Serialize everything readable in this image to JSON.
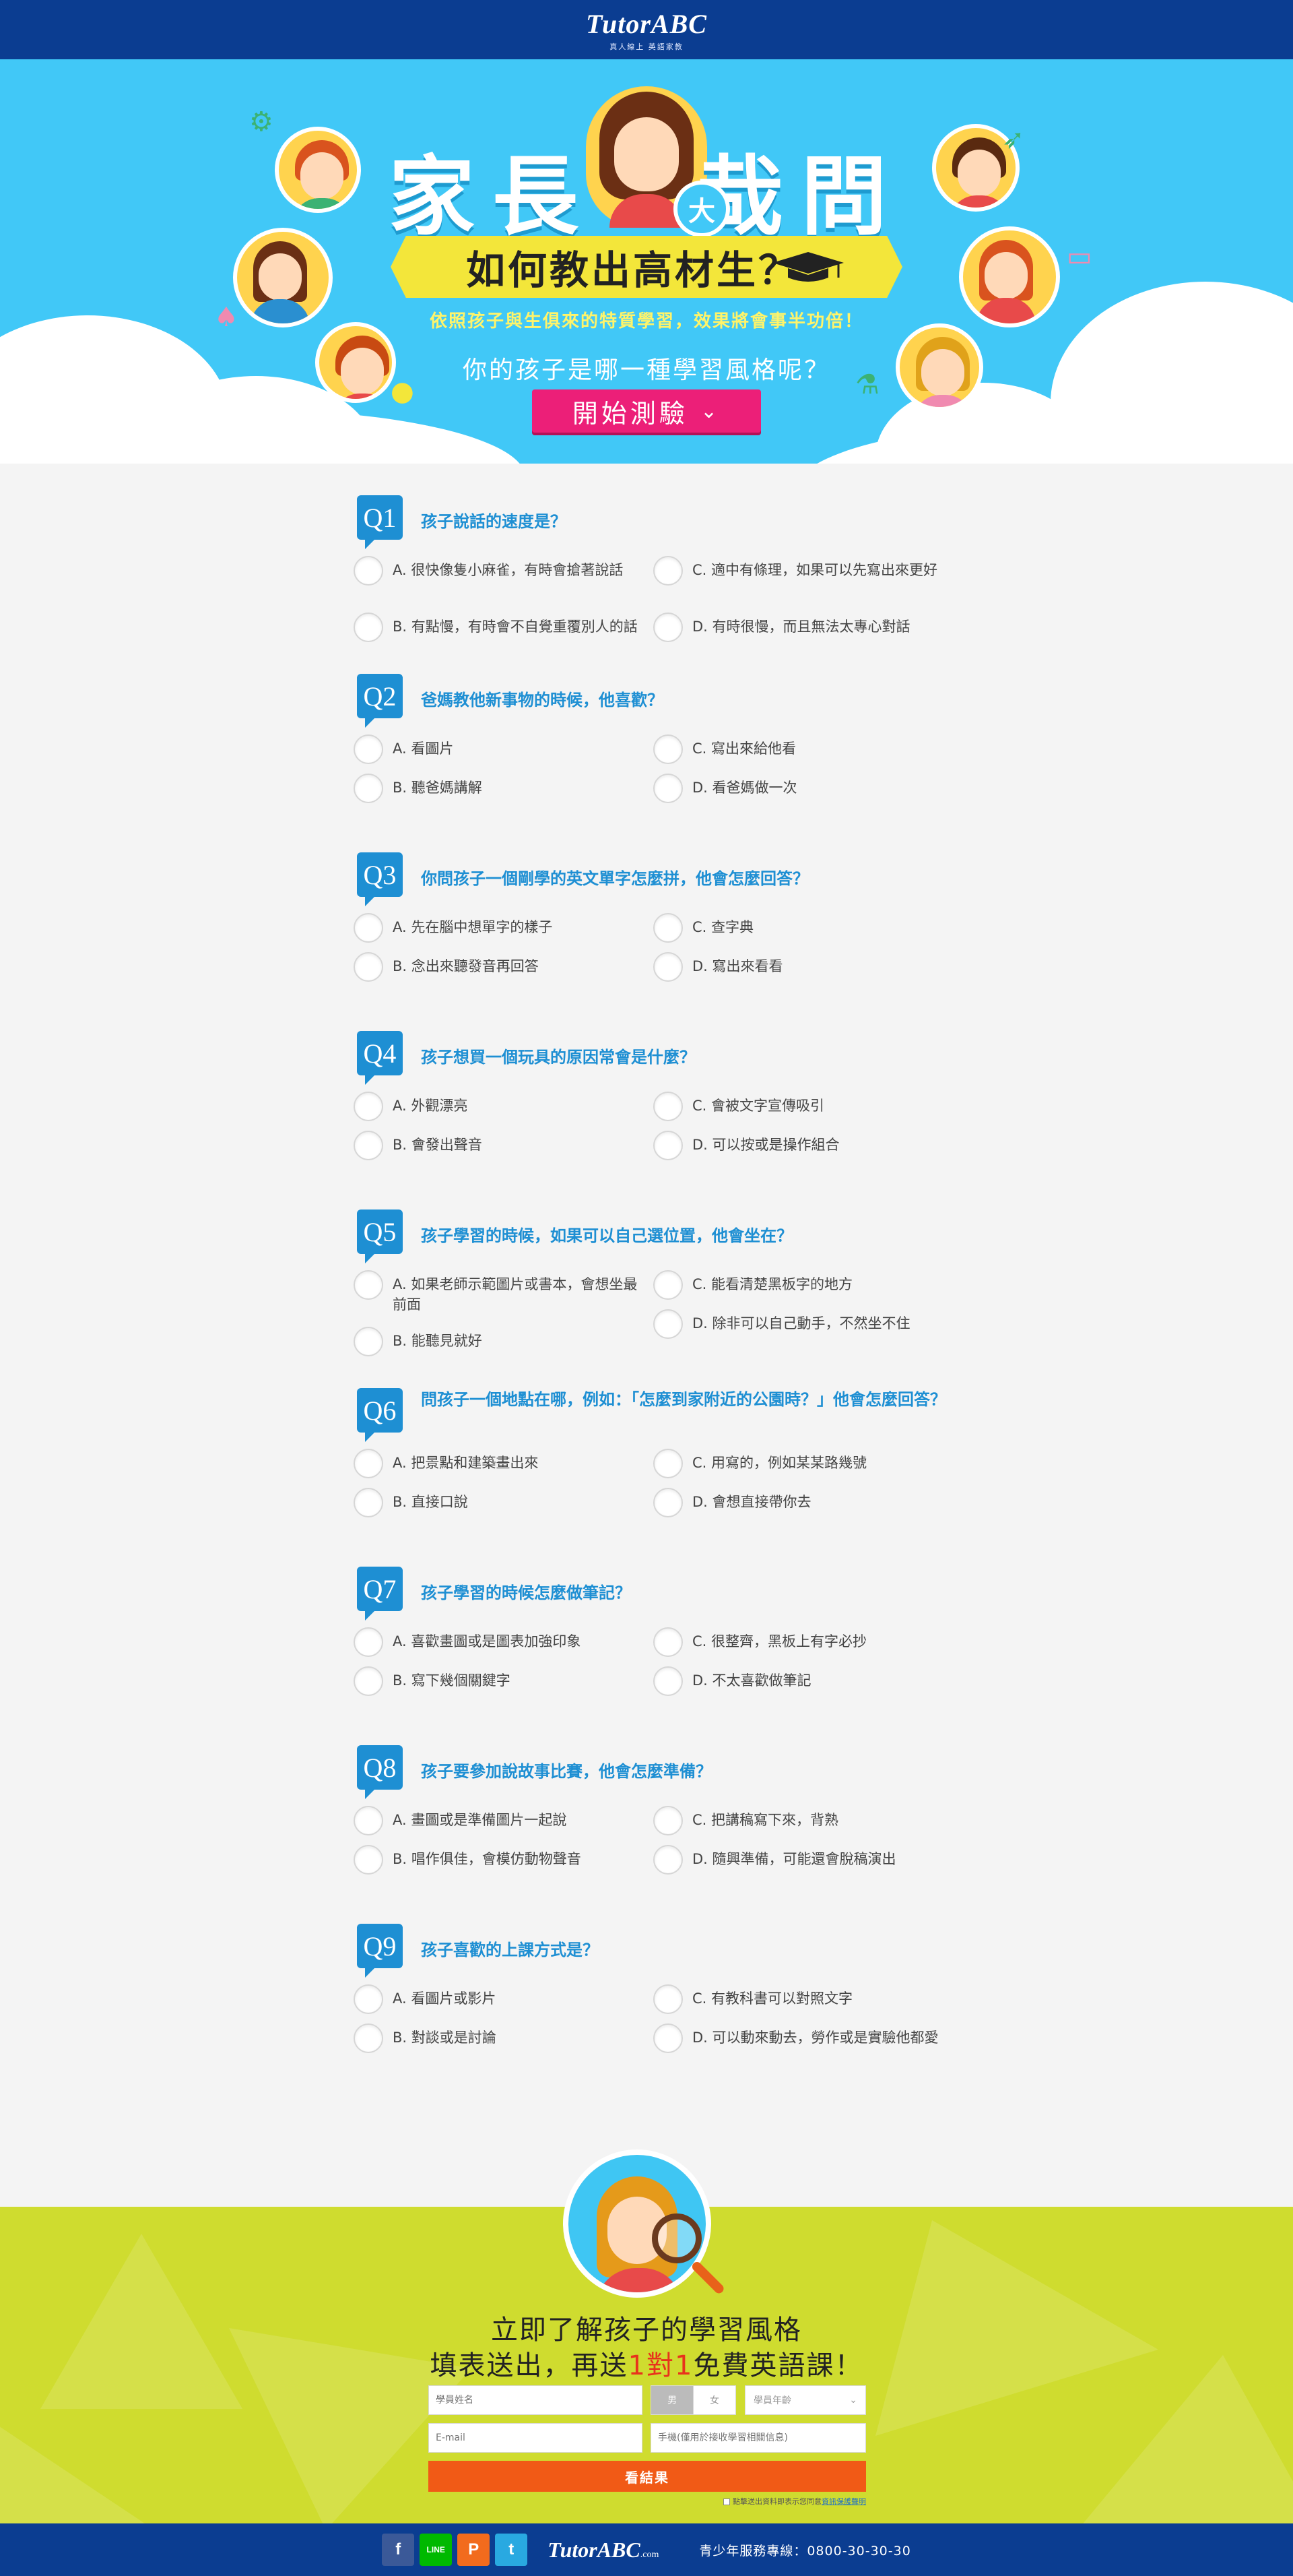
{
  "header": {
    "logo": "TutorABC",
    "tagline": "真人線上  英語家教"
  },
  "hero": {
    "title_left": "家長",
    "title_mid": "大",
    "title_right": "哉問",
    "ribbon": "如何教出高材生？",
    "subtitle": "依照孩子與生俱來的特質學習，效果將會事半功倍！",
    "question": "你的孩子是哪一種學習風格呢？",
    "start_button": "開始測驗",
    "colors": {
      "sky": "#41c8f7",
      "ribbon": "#f3e63a",
      "button": "#ec1f78"
    }
  },
  "quiz": {
    "questions": [
      {
        "num": "Q1",
        "text": "孩子說話的速度是？",
        "options": [
          "A. 很快像隻小麻雀，有時會搶著說話",
          "B. 有點慢，有時會不自覺重覆別人的話",
          "C. 適中有條理，如果可以先寫出來更好",
          "D. 有時很慢，而且無法太專心對話"
        ]
      },
      {
        "num": "Q2",
        "text": "爸媽教他新事物的時候，他喜歡？",
        "options": [
          "A. 看圖片",
          "B. 聽爸媽講解",
          "C. 寫出來給他看",
          "D. 看爸媽做一次"
        ]
      },
      {
        "num": "Q3",
        "text": "你問孩子一個剛學的英文單字怎麼拼，他會怎麼回答？",
        "options": [
          "A. 先在腦中想單字的樣子",
          "B. 念出來聽發音再回答",
          "C. 查字典",
          "D. 寫出來看看"
        ]
      },
      {
        "num": "Q4",
        "text": "孩子想買一個玩具的原因常會是什麼？",
        "options": [
          "A. 外觀漂亮",
          "B. 會發出聲音",
          "C. 會被文字宣傳吸引",
          "D. 可以按或是操作組合"
        ]
      },
      {
        "num": "Q5",
        "text": "孩子學習的時候，如果可以自己選位置，他會坐在？",
        "options": [
          "A. 如果老師示範圖片或書本，會想坐最前面",
          "B. 能聽見就好",
          "C. 能看清楚黑板字的地方",
          "D. 除非可以自己動手，不然坐不住"
        ]
      },
      {
        "num": "Q6",
        "text": "問孩子一個地點在哪，例如：「怎麼到家附近的公園時？」他會怎麼回答？",
        "options": [
          "A. 把景點和建築畫出來",
          "B. 直接口說",
          "C. 用寫的，例如某某路幾號",
          "D. 會想直接帶你去"
        ]
      },
      {
        "num": "Q7",
        "text": "孩子學習的時候怎麼做筆記？",
        "options": [
          "A. 喜歡畫圖或是圖表加強印象",
          "B. 寫下幾個關鍵字",
          "C. 很整齊，黑板上有字必抄",
          "D. 不太喜歡做筆記"
        ]
      },
      {
        "num": "Q8",
        "text": "孩子要參加說故事比賽，他會怎麼準備？",
        "options": [
          "A. 畫圖或是準備圖片一起說",
          "B. 唱作俱佳，會模仿動物聲音",
          "C. 把講稿寫下來，背熟",
          "D. 隨興準備，可能還會脫稿演出"
        ]
      },
      {
        "num": "Q9",
        "text": "孩子喜歡的上課方式是？",
        "options": [
          "A. 看圖片或影片",
          "B. 對談或是討論",
          "C. 有教科書可以對照文字",
          "D. 可以動來動去，勞作或是實驗他都愛"
        ]
      }
    ],
    "accent_color": "#1e8fd3"
  },
  "cta": {
    "line1": "立即了解孩子的學習風格",
    "line2_a": "填表送出，再送",
    "line2_hl": "1對1",
    "line2_b": "免費英語課！"
  },
  "form": {
    "name_placeholder": "學員姓名",
    "gender_male": "男",
    "gender_female": "女",
    "age_label": "學員年齡",
    "email_placeholder": "E-mail",
    "phone_placeholder": "手機(僅用於接收學習相關信息)",
    "submit": "看結果",
    "agree_text": "點擊送出資料即表示您同意",
    "agree_link": "資訊保護聲明"
  },
  "footer": {
    "social": [
      "f",
      "LINE",
      "P",
      "t"
    ],
    "logo": "TutorABC",
    "logo_suffix": ".com",
    "phone": "青少年服務專線：0800-30-30-30"
  }
}
